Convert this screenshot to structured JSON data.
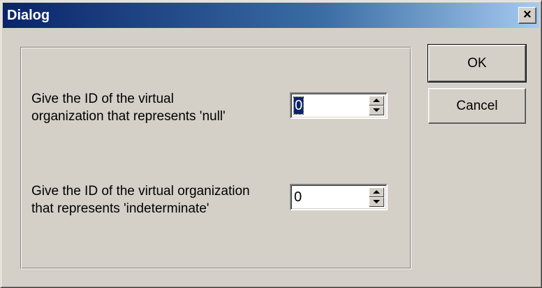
{
  "window": {
    "title": "Dialog",
    "close_label": "×"
  },
  "fields": [
    {
      "label": "Give the ID of the virtual\norganization that represents 'null'",
      "value": "0",
      "selected": true
    },
    {
      "label": "Give the ID of the virtual organization\nthat represents 'indeterminate'",
      "value": "0",
      "selected": false
    }
  ],
  "buttons": {
    "ok": "OK",
    "cancel": "Cancel"
  },
  "colors": {
    "titlebar_start": "#0a246a",
    "titlebar_end": "#a6caf0",
    "face": "#d4d0c8",
    "selection": "#0a246a"
  }
}
